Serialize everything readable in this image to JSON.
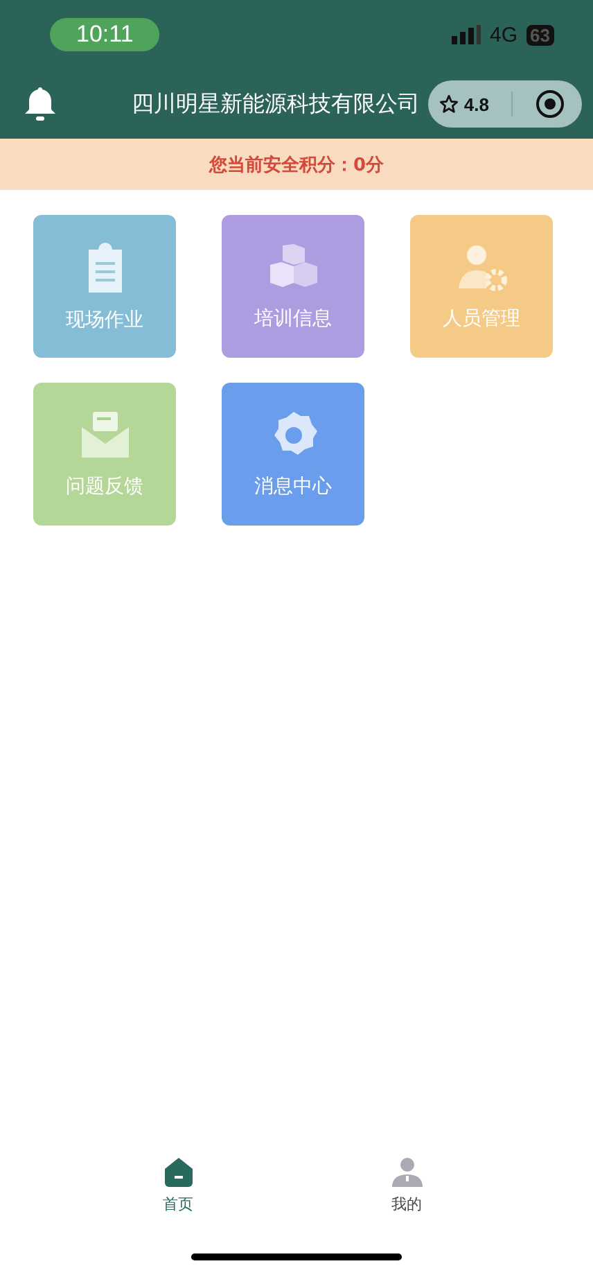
{
  "status_bar": {
    "time": "10:11",
    "network": "4G",
    "battery": "63"
  },
  "header": {
    "title": "四川明星新能源科技有限公司",
    "rating": "4.8"
  },
  "banner": {
    "text": "您当前安全积分：0分"
  },
  "tiles": [
    {
      "label": "现场作业",
      "kind": "clipboard",
      "color": "#86bdd6"
    },
    {
      "label": "培训信息",
      "kind": "cubes",
      "color": "#ad9de0"
    },
    {
      "label": "人员管理",
      "kind": "person",
      "color": "#f5c986"
    },
    {
      "label": "问题反馈",
      "kind": "envelope",
      "color": "#b4d798"
    },
    {
      "label": "消息中心",
      "kind": "gear",
      "color": "#6b9ded"
    }
  ],
  "tab_bar": [
    {
      "label": "首页",
      "kind": "home",
      "selected": true
    },
    {
      "label": "我的",
      "kind": "user",
      "selected": false
    }
  ]
}
